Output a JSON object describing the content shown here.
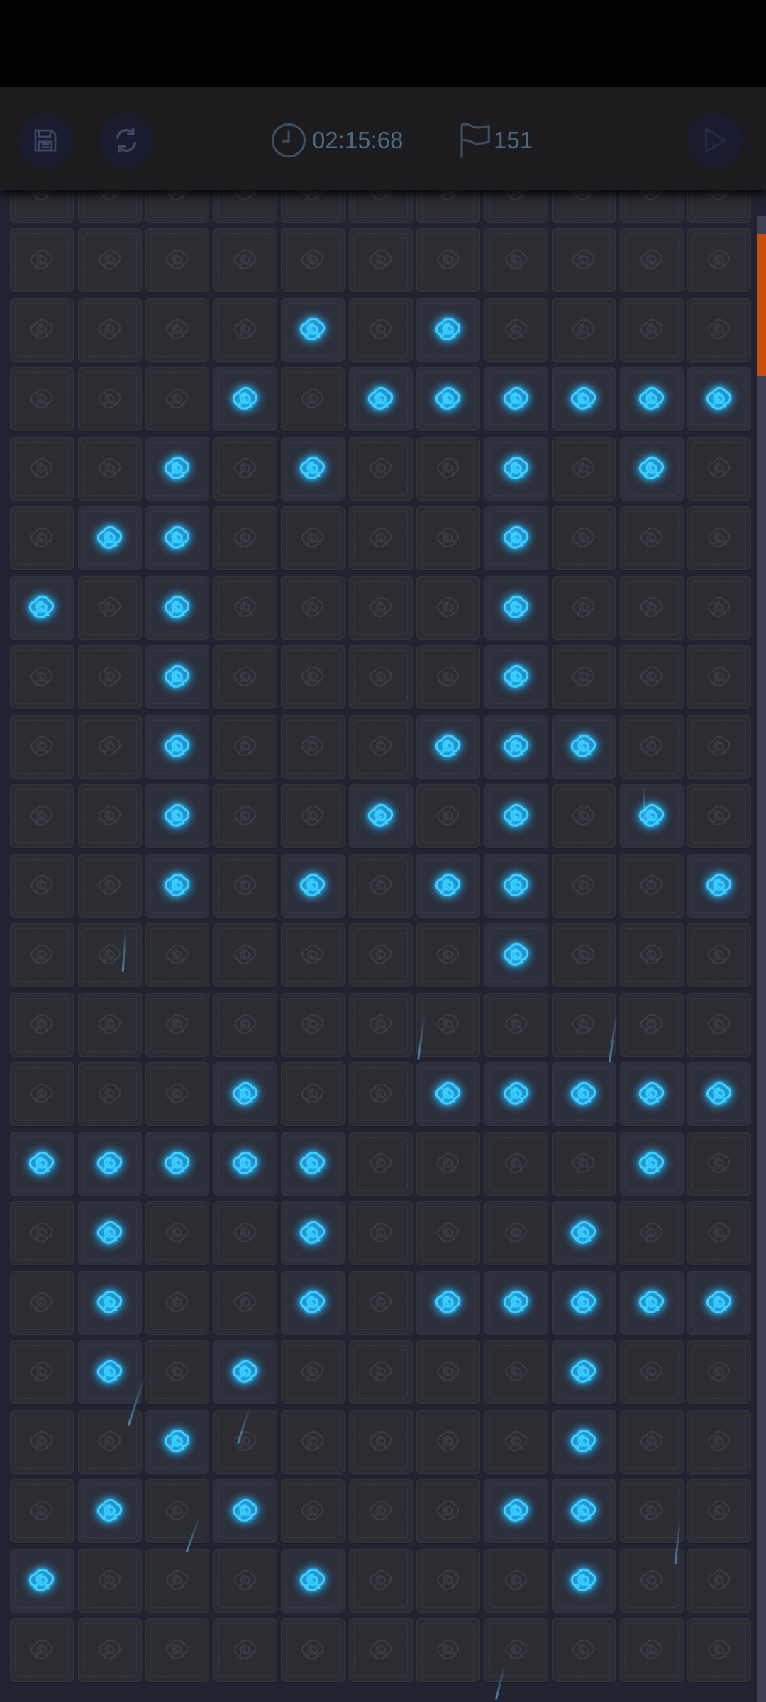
{
  "toolbar": {
    "save_icon": "save-icon",
    "reset_icon": "refresh-icon",
    "timer_icon": "clock-icon",
    "timer": "02:15:68",
    "flag_icon": "flag-icon",
    "flag_count": "151",
    "play_icon": "play-icon"
  },
  "board": {
    "columns": 11,
    "cell_icon": "rose-icon",
    "colors": {
      "background": "#222330",
      "cell": "#2c2c33",
      "active_rose": "#3ad0ff",
      "inactive_rose": "#4a4a52",
      "scroll_thumb": "#c84b10"
    },
    "rows": [
      "00000000000",
      "00000000000",
      "00001010000",
      "00010111111",
      "00101001010",
      "01100001000",
      "10100001000",
      "00100001000",
      "00100011100",
      "00100101010",
      "00101011001",
      "00000001000",
      "00000000000",
      "00010011111",
      "11111000010",
      "01001000100",
      "01001011111",
      "01010000100",
      "00100000100",
      "01010001100",
      "10001000100",
      "00000000000"
    ]
  }
}
